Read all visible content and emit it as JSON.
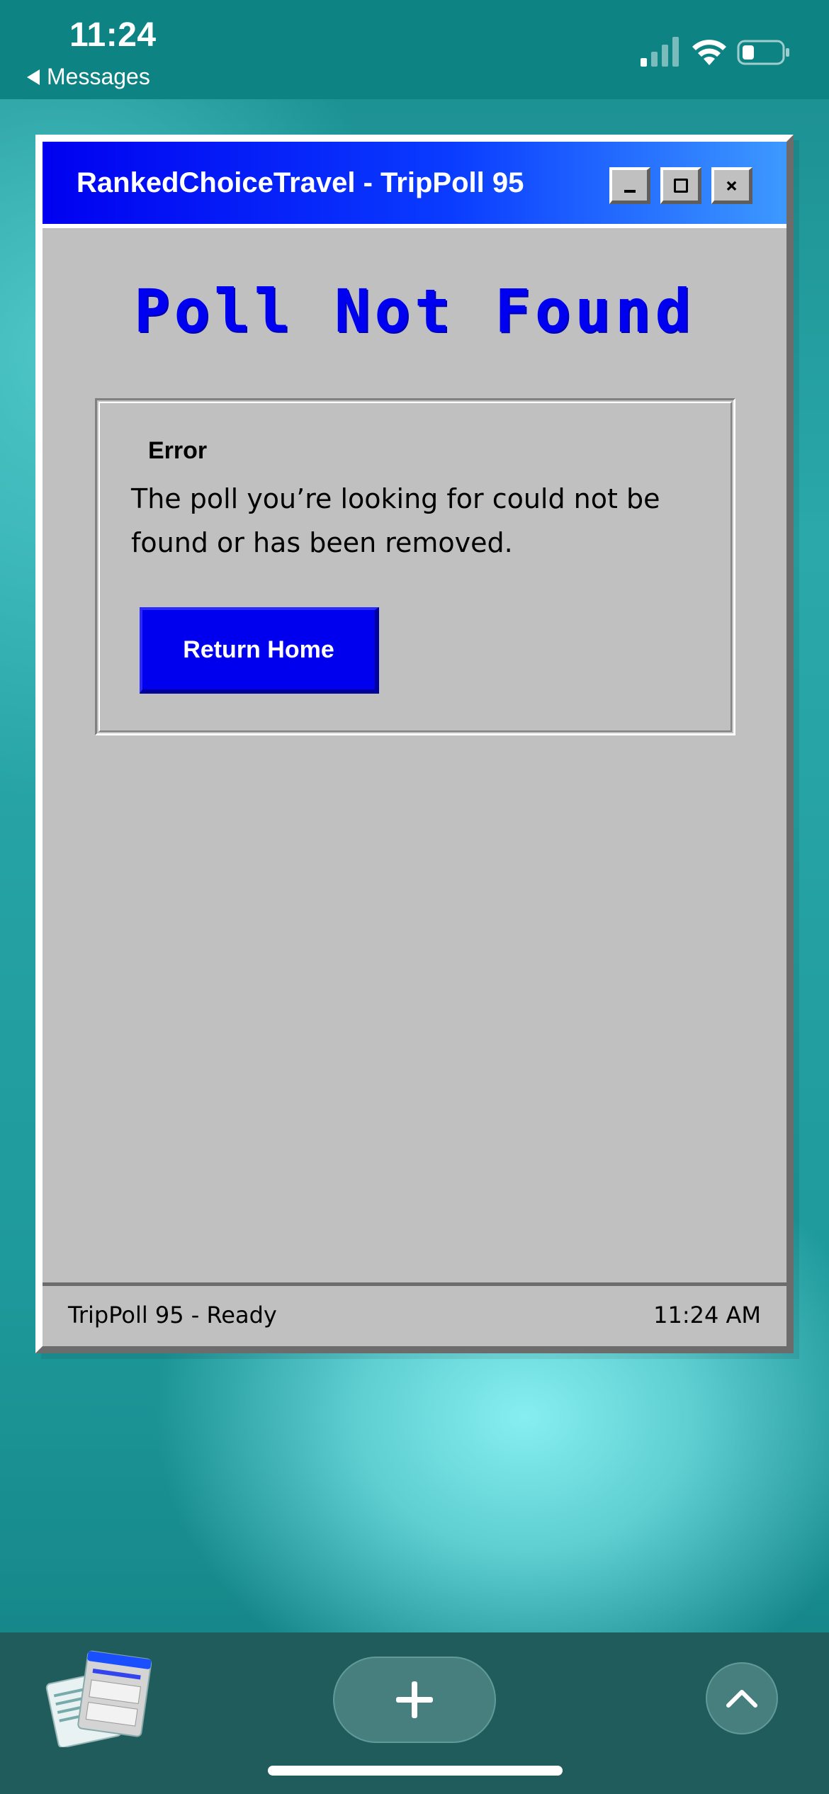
{
  "status_bar": {
    "time": "11:24",
    "back_label": "Messages",
    "icons": [
      "cellular-signal-icon",
      "wifi-icon",
      "battery-icon"
    ]
  },
  "window": {
    "title": "RankedChoiceTravel - TripPoll 95",
    "controls": {
      "minimize_glyph": "_",
      "maximize_glyph": "□",
      "close_glyph": "×"
    },
    "heading": "Poll Not Found",
    "error": {
      "label": "Error",
      "message": "The poll you’re looking for could not be found or has been removed.",
      "button_label": "Return Home"
    },
    "status": {
      "left": "TripPoll 95 - Ready",
      "right": "11:24 AM"
    }
  },
  "dock": {
    "icons": [
      "app-switcher-thumbnail",
      "plus-icon",
      "chevron-up-icon"
    ]
  },
  "colors": {
    "accent_blue": "#0000f0",
    "window_gray": "#c0c0c0",
    "teal_background": "#1f9a9c"
  }
}
